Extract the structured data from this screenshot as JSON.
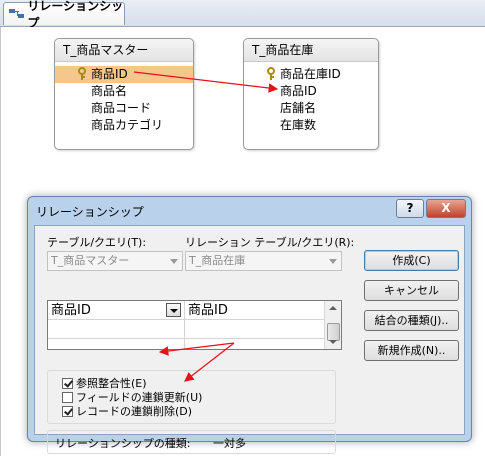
{
  "document_tab": {
    "label": "リレーションシップ"
  },
  "tables": [
    {
      "title": "T_商品マスター",
      "fields": [
        "商品ID",
        "商品名",
        "商品コード",
        "商品カテゴリ"
      ]
    },
    {
      "title": "T_商品在庫",
      "fields": [
        "商品在庫ID",
        "商品ID",
        "店舗名",
        "在庫数"
      ]
    }
  ],
  "dialog": {
    "title": "リレーションシップ",
    "help_button": "?",
    "close_button": "X",
    "table_query_label": "テーブル/クエリ(T):",
    "related_table_label": "リレーション テーブル/クエリ(R):",
    "table_value": "T_商品マスター",
    "related_value": "T_商品在庫",
    "field_left": "商品ID",
    "field_right": "商品ID",
    "checkboxes": [
      {
        "label": "参照整合性(E)",
        "checked": true
      },
      {
        "label": "フィールドの連鎖更新(U)",
        "checked": false
      },
      {
        "label": "レコードの連鎖削除(D)",
        "checked": true
      }
    ],
    "relationship_type_label": "リレーションシップの種類:",
    "relationship_type_value": "一対多",
    "buttons": {
      "create": "作成(C)",
      "cancel": "キャンセル",
      "join_type": "結合の種類(J)..",
      "new": "新規作成(N).."
    }
  },
  "colors": {
    "selected_field": "#f5c78c",
    "annotation_arrow": "#e8101a",
    "dialog_frame": "#b9d1ea"
  }
}
